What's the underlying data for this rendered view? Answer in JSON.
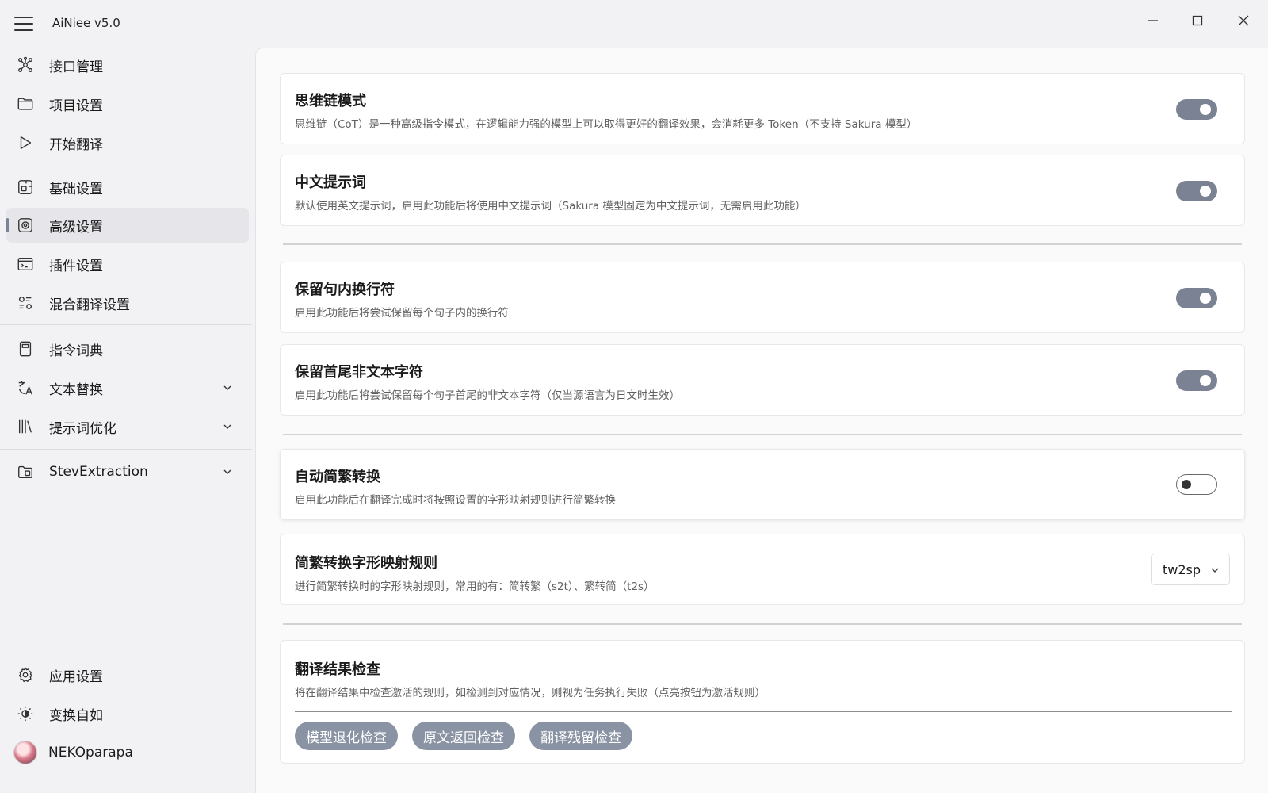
{
  "app": {
    "title": "AiNiee v5.0"
  },
  "sidebar": {
    "items": [
      {
        "label": "接口管理",
        "icon": "network-icon"
      },
      {
        "label": "项目设置",
        "icon": "folder-icon"
      },
      {
        "label": "开始翻译",
        "icon": "play-icon"
      },
      {
        "label": "基础设置",
        "icon": "basic-settings-icon"
      },
      {
        "label": "高级设置",
        "icon": "advanced-settings-icon",
        "active": true
      },
      {
        "label": "插件设置",
        "icon": "plugin-icon"
      },
      {
        "label": "混合翻译设置",
        "icon": "mixed-translation-icon"
      },
      {
        "label": "指令词典",
        "icon": "book-icon"
      },
      {
        "label": "文本替换",
        "icon": "text-replace-icon"
      },
      {
        "label": "提示词优化",
        "icon": "library-icon"
      },
      {
        "label": "StevExtraction",
        "icon": "extraction-icon"
      }
    ],
    "bottom": [
      {
        "label": "应用设置",
        "icon": "gear-icon"
      },
      {
        "label": "变换自如",
        "icon": "theme-toggle-icon"
      },
      {
        "label": "NEKOparapa",
        "icon": "avatar"
      }
    ]
  },
  "settings": {
    "cot": {
      "title": "思维链模式",
      "desc": "思维链（CoT）是一种高级指令模式，在逻辑能力强的模型上可以取得更好的翻译效果，会消耗更多 Token（不支持 Sakura 模型）",
      "enabled": true
    },
    "cn_prompt": {
      "title": "中文提示词",
      "desc": "默认使用英文提示词，启用此功能后将使用中文提示词（Sakura 模型固定为中文提示词，无需启用此功能）",
      "enabled": true
    },
    "keep_linebreak": {
      "title": "保留句内换行符",
      "desc": "启用此功能后将尝试保留每个句子内的换行符",
      "enabled": true
    },
    "keep_nontext": {
      "title": "保留首尾非文本字符",
      "desc": "启用此功能后将尝试保留每个句子首尾的非文本字符（仅当源语言为日文时生效）",
      "enabled": true
    },
    "auto_convert": {
      "title": "自动简繁转换",
      "desc": "启用此功能后在翻译完成时将按照设置的字形映射规则进行简繁转换",
      "enabled": false
    },
    "convert_rule": {
      "title": "简繁转换字形映射规则",
      "desc": "进行简繁转换时的字形映射规则，常用的有：简转繁（s2t）、繁转简（t2s）",
      "value": "tw2sp"
    },
    "result_check": {
      "title": "翻译结果检查",
      "desc": "将在翻译结果中检查激活的规则，如检测到对应情况，则视为任务执行失败（点亮按钮为激活规则）",
      "buttons": [
        "模型退化检查",
        "原文返回检查",
        "翻译残留检查"
      ]
    }
  },
  "colors": {
    "accent": "#7a8294",
    "pill": "#8a93a4",
    "active_bg": "#e6e6ea"
  }
}
